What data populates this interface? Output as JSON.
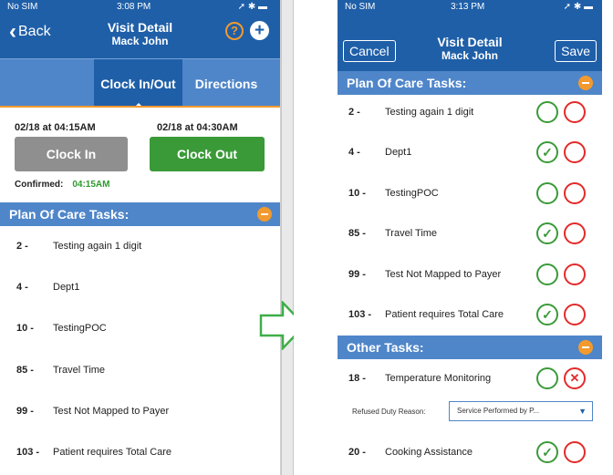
{
  "left": {
    "status": {
      "carrier": "No SIM",
      "time": "3:08 PM"
    },
    "header": {
      "back_label": "Back",
      "title": "Visit Detail",
      "subtitle": "Mack John"
    },
    "tabs": {
      "clock": "Clock In/Out",
      "directions": "Directions"
    },
    "clock": {
      "in_time": "02/18 at 04:15AM",
      "out_time": "02/18 at 04:30AM",
      "in_label": "Clock In",
      "out_label": "Clock Out",
      "confirmed_label": "Confirmed:",
      "confirmed_value": "04:15AM"
    },
    "plan_title": "Plan Of Care Tasks:",
    "tasks": [
      {
        "num": "2 -",
        "text": "Testing again 1 digit"
      },
      {
        "num": "4 -",
        "text": "Dept1"
      },
      {
        "num": "10 -",
        "text": "TestingPOC"
      },
      {
        "num": "85 -",
        "text": "Travel Time"
      },
      {
        "num": "99 -",
        "text": "Test Not Mapped to Payer"
      },
      {
        "num": "103 -",
        "text": "Patient requires Total Care"
      }
    ]
  },
  "right": {
    "status": {
      "carrier": "No SIM",
      "time": "3:13 PM"
    },
    "header": {
      "cancel_label": "Cancel",
      "title": "Visit Detail",
      "subtitle": "Mack John",
      "save_label": "Save"
    },
    "plan_title": "Plan Of Care Tasks:",
    "tasks": [
      {
        "num": "2 -",
        "text": "Testing again 1 digit",
        "state": "none"
      },
      {
        "num": "4 -",
        "text": "Dept1",
        "state": "done"
      },
      {
        "num": "10 -",
        "text": "TestingPOC",
        "state": "none"
      },
      {
        "num": "85 -",
        "text": "Travel Time",
        "state": "done"
      },
      {
        "num": "99 -",
        "text": "Test Not Mapped to Payer",
        "state": "none"
      },
      {
        "num": "103 -",
        "text": "Patient requires Total Care",
        "state": "done"
      }
    ],
    "other_title": "Other Tasks:",
    "other_tasks": [
      {
        "num": "18 -",
        "text": "Temperature Monitoring",
        "state": "refused"
      },
      {
        "num": "20 -",
        "text": "Cooking Assistance",
        "state": "done"
      }
    ],
    "refused_label": "Refused Duty Reason:",
    "refused_value": "Service Performed by P..."
  },
  "colors": {
    "nav_blue": "#1f5fa8",
    "section_blue": "#4f86c9",
    "accent_orange": "#f29a2e",
    "green": "#3a9a38",
    "red": "#e32a2a"
  }
}
